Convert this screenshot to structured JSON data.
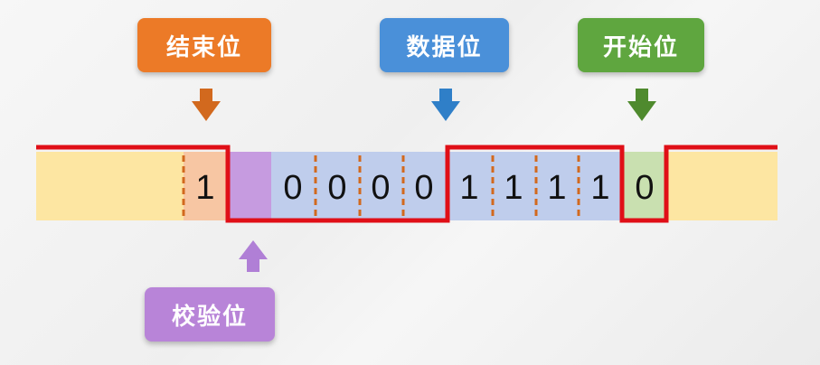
{
  "labels": {
    "stop_bit": "结束位",
    "data_bits": "数据位",
    "start_bit": "开始位",
    "parity_bit": "校验位"
  },
  "frame": {
    "stop_bit": "1",
    "parity_bit": "",
    "data_bits": [
      "0",
      "0",
      "0",
      "0",
      "1",
      "1",
      "1",
      "1"
    ],
    "start_bit": "0"
  },
  "colors": {
    "stop_label": "#ec7a27",
    "data_label": "#4a90d9",
    "start_label": "#5fa63f",
    "parity_label": "#b884d8",
    "idle_fill": "#fde6a2",
    "stop_fill": "#f7c6a3",
    "parity_fill": "#c69be0",
    "data_fill": "#bfcdec",
    "start_fill": "#c9e0b0",
    "signal_line": "#e00f17",
    "divider": "#d2691e"
  }
}
